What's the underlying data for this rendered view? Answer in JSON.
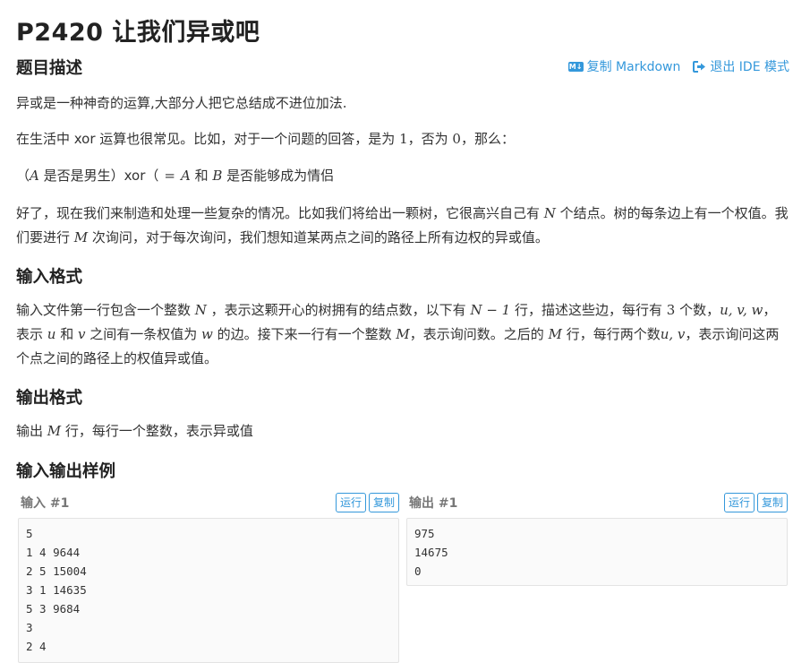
{
  "problem": {
    "title": "P2420 让我们异或吧"
  },
  "toolbar": {
    "copy_markdown": "复制 Markdown",
    "exit_ide": "退出 IDE 模式"
  },
  "sections": {
    "description": "题目描述",
    "input_format": "输入格式",
    "output_format": "输出格式",
    "samples": "输入输出样例"
  },
  "description": {
    "p1": "异或是一种神奇的运算,大部分人把它总结成不进位加法.",
    "p2_a": "在生活中 xor 运算也很常见。比如，对于一个问题的回答，是为 ",
    "p2_one": "1",
    "p2_b": "，否为 ",
    "p2_zero": "0",
    "p2_c": "，那么：",
    "p3_a": "（",
    "p3_A": "A",
    "p3_b": " 是否是男生）xor（",
    "p3_B": "B",
    "p3_c": " 是否是男生）",
    "p3_eq": "=",
    "p3_A2": "A",
    "p3_d": " 和 ",
    "p3_B2": "B",
    "p3_e": " 是否能够成为情侣",
    "p4_a": "好了，现在我们来制造和处理一些复杂的情况。比如我们将给出一颗树，它很高兴自己有 ",
    "p4_N": "N",
    "p4_b": " 个结点。树的每条边上有一个权值。我们要进行 ",
    "p4_M": "M",
    "p4_c": " 次询问，对于每次询问，我们想知道某两点之间的路径上所有边权的异或值。"
  },
  "input_format": {
    "a": "输入文件第一行包含一个整数 ",
    "N": "N",
    "b": " ，表示这颗开心的树拥有的结点数，以下有 ",
    "N1": "N − 1",
    "c": " 行，描述这些边，每行有 ",
    "three": "3",
    "d": " 个数，",
    "uvw": "u, v, w",
    "e": "，表示 ",
    "u": "u",
    "f": " 和 ",
    "v": "v",
    "g": " 之间有一条权值为 ",
    "w": "w",
    "h": " 的边。接下来一行有一个整数 ",
    "M": "M",
    "i": "，表示询问数。之后的 ",
    "M2": "M",
    "j": " 行，每行两个数",
    "uv": "u, v",
    "k": "，表示询问这两个点之间的路径上的权值异或值。"
  },
  "output_format": {
    "a": "输出 ",
    "M": "M",
    "b": " 行，每行一个整数，表示异或值"
  },
  "samples": {
    "input": {
      "label": "输入 #1",
      "run": "运行",
      "copy": "复制",
      "lines": [
        "5",
        "1 4 9644",
        "2 5 15004",
        "3 1 14635",
        "5 3 9684",
        "3",
        "2 4"
      ]
    },
    "output": {
      "label": "输出 #1",
      "run": "运行",
      "copy": "复制",
      "lines": [
        "975",
        "14675",
        "0"
      ]
    }
  }
}
